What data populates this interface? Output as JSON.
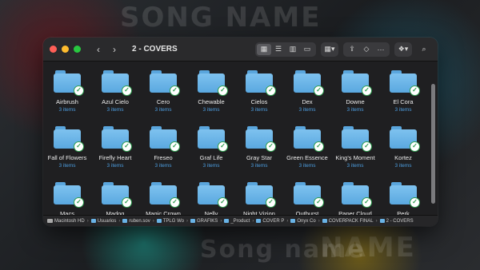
{
  "window": {
    "title": "2 - COVERS"
  },
  "colors": {
    "close": "#ff5f57",
    "minimize": "#febc2e",
    "zoom": "#28c840",
    "folder": "#6ab6ea",
    "sync_check": "#2e9e4f"
  },
  "toolbar": {
    "views": [
      "icon-view-icon",
      "list-view-icon",
      "column-view-icon",
      "gallery-view-icon"
    ],
    "group_icon": "group-grid-icon",
    "share_icon": "share-icon",
    "tag_icon": "tag-icon",
    "more_icon": "more-icon",
    "dropbox_icon": "dropbox-icon",
    "search_icon": "search-icon"
  },
  "folders": [
    {
      "name": "Airbrush",
      "count": "3 items"
    },
    {
      "name": "Azul Cielo",
      "count": "3 items"
    },
    {
      "name": "Cero",
      "count": "3 items"
    },
    {
      "name": "Chewable",
      "count": "3 items"
    },
    {
      "name": "Cielos",
      "count": "3 items"
    },
    {
      "name": "Dex",
      "count": "3 items"
    },
    {
      "name": "Downe",
      "count": "3 items"
    },
    {
      "name": "El Cora",
      "count": "3 items"
    },
    {
      "name": "Fall of Flowers",
      "count": "3 items"
    },
    {
      "name": "Firefly Heart",
      "count": "3 items"
    },
    {
      "name": "Freseo",
      "count": "3 items"
    },
    {
      "name": "Graf Life",
      "count": "3 items"
    },
    {
      "name": "Gray Star",
      "count": "3 items"
    },
    {
      "name": "Green Essence",
      "count": "3 items"
    },
    {
      "name": "King's Moment",
      "count": "3 items"
    },
    {
      "name": "Kortez",
      "count": "3 items"
    },
    {
      "name": "Macs",
      "count": ""
    },
    {
      "name": "Madog",
      "count": ""
    },
    {
      "name": "Magic Crown",
      "count": ""
    },
    {
      "name": "Nelly",
      "count": ""
    },
    {
      "name": "Night Vizion",
      "count": ""
    },
    {
      "name": "Outburst",
      "count": ""
    },
    {
      "name": "Paper Cloud",
      "count": ""
    },
    {
      "name": "Perk",
      "count": ""
    }
  ],
  "path": [
    {
      "label": "Macintosh HD",
      "type": "disk"
    },
    {
      "label": "Usuarios",
      "type": "folder"
    },
    {
      "label": "ruben.sov",
      "type": "folder"
    },
    {
      "label": "TPLG Wo",
      "type": "folder"
    },
    {
      "label": "GRAFIKS",
      "type": "folder"
    },
    {
      "label": "_Product",
      "type": "folder"
    },
    {
      "label": "COVER P",
      "type": "folder"
    },
    {
      "label": "Onyx Co",
      "type": "folder"
    },
    {
      "label": "COVERPACK FINAL",
      "type": "folder"
    },
    {
      "label": "2 - COVERS",
      "type": "folder"
    }
  ]
}
